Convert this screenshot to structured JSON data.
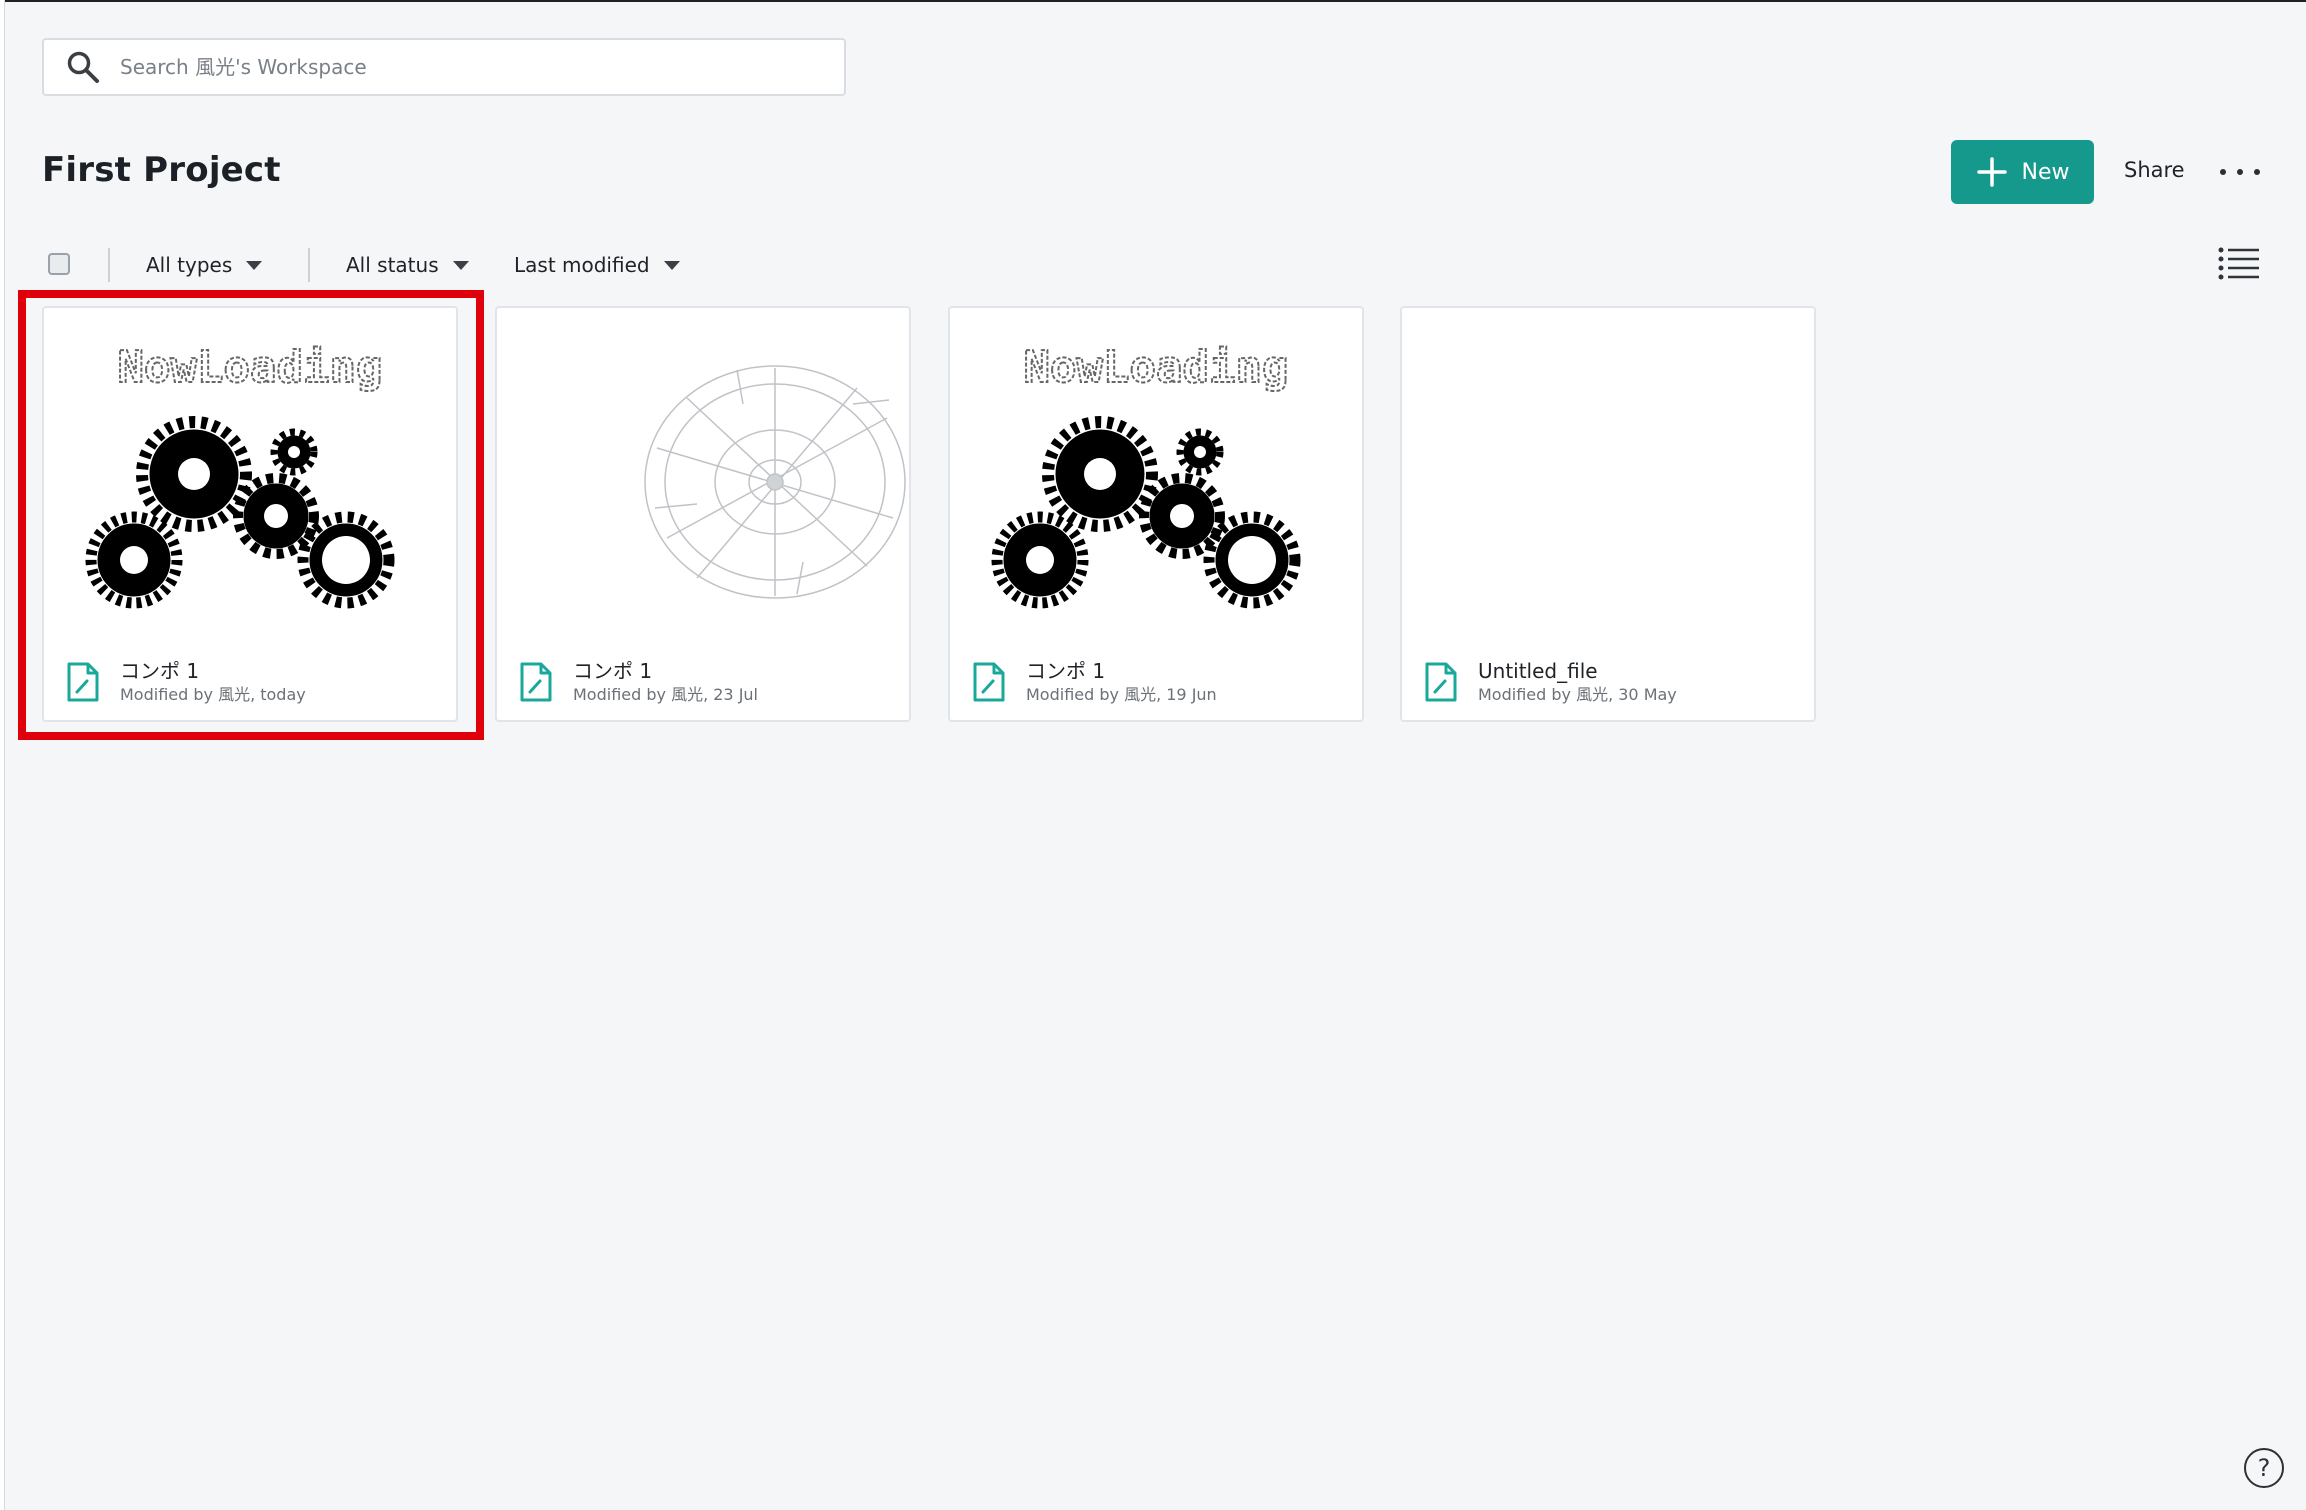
{
  "search": {
    "placeholder": "Search 風光's Workspace"
  },
  "header": {
    "title": "First Project",
    "new_label": "New",
    "share_label": "Share"
  },
  "toolbar": {
    "type_filter": "All types",
    "status_filter": "All status",
    "sort": "Last modified"
  },
  "colors": {
    "accent": "#14998c",
    "highlight": "#e0000b",
    "background": "#f4f6f8"
  },
  "files": [
    {
      "name": "コンポ 1",
      "modified": "Modified by 風光, today",
      "thumbnail": "now-loading-gears"
    },
    {
      "name": "コンポ 1",
      "modified": "Modified by 風光, 23 Jul",
      "thumbnail": "clock-sketch"
    },
    {
      "name": "コンポ 1",
      "modified": "Modified by 風光, 19 Jun",
      "thumbnail": "now-loading-gears"
    },
    {
      "name": "Untitled_file",
      "modified": "Modified by 風光, 30 May",
      "thumbnail": "blank"
    }
  ],
  "thumbnail_text": "NowLoading",
  "help": {
    "label": "?"
  }
}
